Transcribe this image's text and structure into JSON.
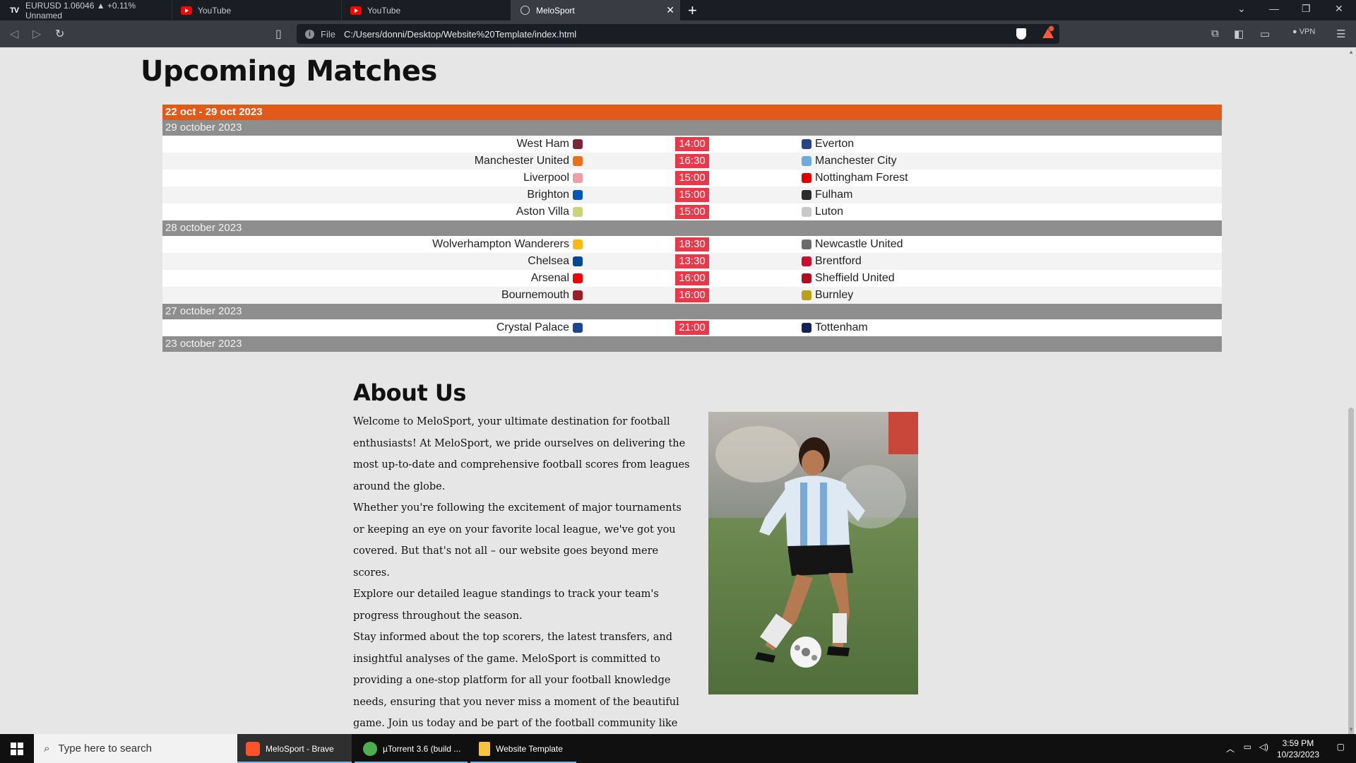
{
  "browser": {
    "tabs": [
      {
        "label": "EURUSD 1.06046 ▲ +0.11% Unnamed",
        "icon": "tradingview-icon"
      },
      {
        "label": "YouTube",
        "icon": "youtube-icon"
      },
      {
        "label": "YouTube",
        "icon": "youtube-icon"
      },
      {
        "label": "MeloSport",
        "icon": "globe-icon",
        "active": true
      }
    ],
    "new_tab": "+",
    "address": {
      "scheme": "File",
      "url": "C:/Users/donni/Desktop/Website%20Template/index.html"
    },
    "vpn_label": "VPN"
  },
  "page": {
    "upcoming_title": "Upcoming Matches",
    "range_label": "22 oct - 29 oct 2023",
    "days": [
      {
        "date": "29 october 2023",
        "matches": [
          {
            "home": "West Ham",
            "time": "14:00",
            "away": "Everton",
            "home_color": "#7a263a",
            "away_color": "#274488"
          },
          {
            "home": "Manchester United",
            "time": "16:30",
            "away": "Manchester City",
            "home_color": "#e86f1c",
            "away_color": "#6cabdd"
          },
          {
            "home": "Liverpool",
            "time": "15:00",
            "away": "Nottingham Forest",
            "home_color": "#e9a0a8",
            "away_color": "#dd0000"
          },
          {
            "home": "Brighton",
            "time": "15:00",
            "away": "Fulham",
            "home_color": "#0057b8",
            "away_color": "#2b2b2b"
          },
          {
            "home": "Aston Villa",
            "time": "15:00",
            "away": "Luton",
            "home_color": "#c9d37a",
            "away_color": "#c8c8c8"
          }
        ]
      },
      {
        "date": "28 october 2023",
        "matches": [
          {
            "home": "Wolverhampton Wanderers",
            "time": "18:30",
            "away": "Newcastle United",
            "home_color": "#fdb913",
            "away_color": "#6b6b6b"
          },
          {
            "home": "Chelsea",
            "time": "13:30",
            "away": "Brentford",
            "home_color": "#034694",
            "away_color": "#c8102e"
          },
          {
            "home": "Arsenal",
            "time": "16:00",
            "away": "Sheffield United",
            "home_color": "#ef0107",
            "away_color": "#b10d1c"
          },
          {
            "home": "Bournemouth",
            "time": "16:00",
            "away": "Burnley",
            "home_color": "#9b1d2a",
            "away_color": "#b8a21a"
          }
        ]
      },
      {
        "date": "27 october 2023",
        "matches": [
          {
            "home": "Crystal Palace",
            "time": "21:00",
            "away": "Tottenham",
            "home_color": "#1b458f",
            "away_color": "#132257"
          }
        ]
      },
      {
        "date": "23 october 2023",
        "matches": []
      }
    ],
    "about_title": "About Us",
    "about_paragraphs": [
      "Welcome to MeloSport, your ultimate destination for football enthusiasts! At MeloSport, we pride ourselves on delivering the most up-to-date and comprehensive football scores from leagues around the globe.",
      "Whether you're following the excitement of major tournaments or keeping an eye on your favorite local league, we've got you covered. But that's not all – our website goes beyond mere scores.",
      "Explore our detailed league standings to track your team's progress throughout the season.",
      "Stay informed about the top scorers, the latest transfers, and insightful analyses of the game. MeloSport is committed to providing a one-stop platform for all your football knowledge needs, ensuring that you never miss a moment of the beautiful game. Join us today and be part of the football community like never before!"
    ]
  },
  "taskbar": {
    "search_placeholder": "Type here to search",
    "apps": [
      {
        "label": "MeloSport - Brave",
        "color": "#fb542b"
      },
      {
        "label": "µTorrent 3.6  (build ...",
        "color": "#4caf50"
      },
      {
        "label": "Website Template",
        "color": "#f5c542"
      }
    ],
    "time": "3:59 PM",
    "date": "10/23/2023"
  }
}
